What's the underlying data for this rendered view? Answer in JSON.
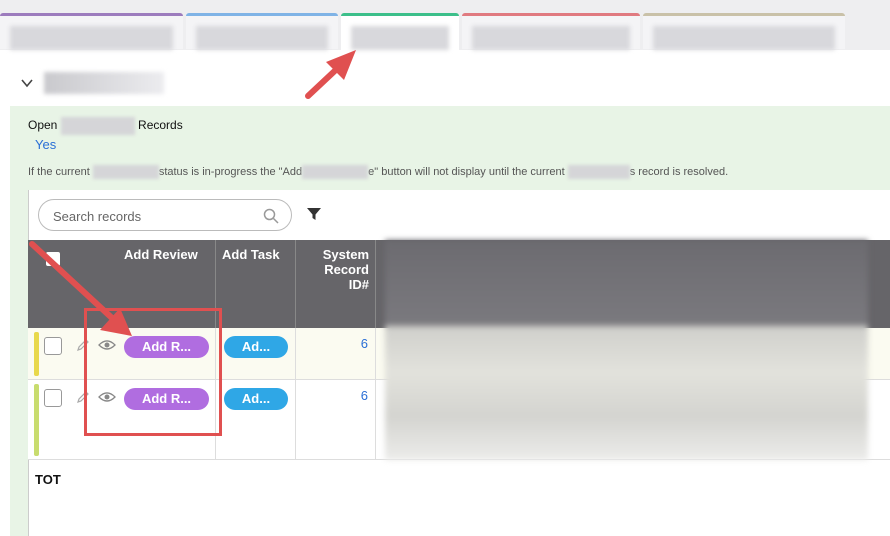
{
  "section": {
    "open_prefix": "Open",
    "open_suffix": "Records",
    "open_value": "Yes"
  },
  "note": {
    "part1": "If the current",
    "part2": "status is in-progress the \"Add",
    "part3": "e\" button will not display until the current",
    "part4": "s record is resolved."
  },
  "search": {
    "placeholder": "Search records"
  },
  "table": {
    "headers": {
      "add_review": "Add Review",
      "add_task": "Add Task",
      "system_id_line1": "System",
      "system_id_line2": "Record",
      "system_id_line3": "ID#"
    },
    "rows": [
      {
        "add_review_label": "Add R...",
        "add_task_label": "Ad...",
        "system_id": "6"
      },
      {
        "add_review_label": "Add R...",
        "add_task_label": "Ad...",
        "system_id": "6"
      }
    ],
    "footer": "TOT"
  },
  "colors": {
    "review_button": "#b06de0",
    "task_button": "#2fa7e6",
    "annotation": "#e05050"
  },
  "icons": [
    "chevron-down-icon",
    "search-icon",
    "filter-icon",
    "pencil-icon",
    "eye-icon"
  ]
}
